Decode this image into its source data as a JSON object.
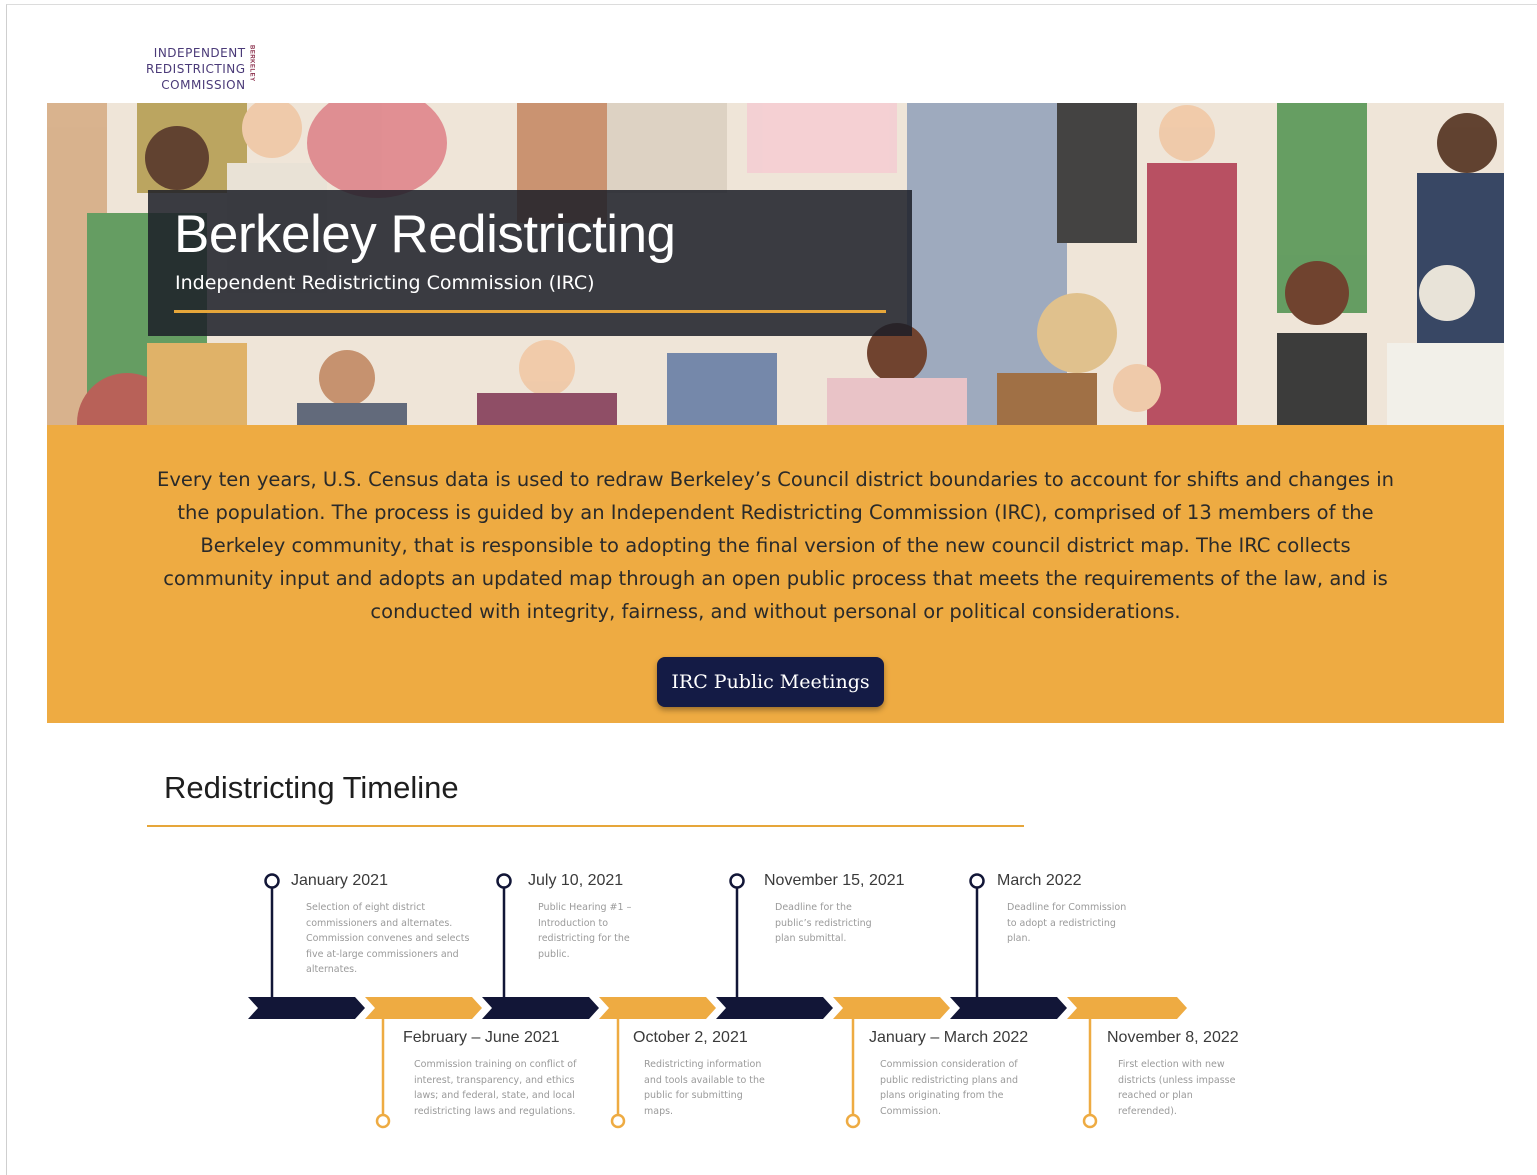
{
  "logo": {
    "line1": "INDEPENDENT",
    "line2": "REDISTRICTING",
    "line3": "COMMISSION",
    "side": "BERKELEY"
  },
  "hero": {
    "title": "Berkeley Redistricting",
    "subtitle": "Independent Redistricting Commission (IRC)"
  },
  "intro": {
    "text": "Every ten years, U.S. Census data is used to redraw Berkeley’s Council district boundaries to account for shifts and changes in the population. The process is guided by an Independent Redistricting Commission (IRC), comprised of 13 members of the Berkeley community, that is responsible to adopting the final version of the new council district map. The IRC collects community input and adopts an updated map through an open public process that meets the requirements of the law, and is conducted with integrity, fairness, and without personal or political considerations.",
    "button_label": "IRC Public Meetings"
  },
  "timeline": {
    "heading": "Redistricting Timeline",
    "colors": {
      "navy": "#121637",
      "gold": "#eeab42"
    },
    "events": [
      {
        "date": "January 2021",
        "desc": "Selection of eight district commissioners and alternates. Commission convenes and selects five at-large commissioners and alternates."
      },
      {
        "date": "February – June 2021",
        "desc": "Commission training on conflict of interest, transparency, and ethics laws; and federal, state, and local redistricting laws and regulations."
      },
      {
        "date": "July 10, 2021",
        "desc": "Public Hearing #1 – Introduction to redistricting for the public."
      },
      {
        "date": "October 2, 2021",
        "desc": "Redistricting information and tools available to the public for submitting maps."
      },
      {
        "date": "November 15, 2021",
        "desc": "Deadline for the public’s redistricting plan submittal."
      },
      {
        "date": "January – March 2022",
        "desc": "Commission consideration of public redistricting plans and plans originating from the Commission."
      },
      {
        "date": "March 2022",
        "desc": "Deadline for Commission to adopt a redistricting plan."
      },
      {
        "date": "November 8, 2022",
        "desc": "First election with new districts (unless impasse reached or plan referended)."
      }
    ]
  }
}
